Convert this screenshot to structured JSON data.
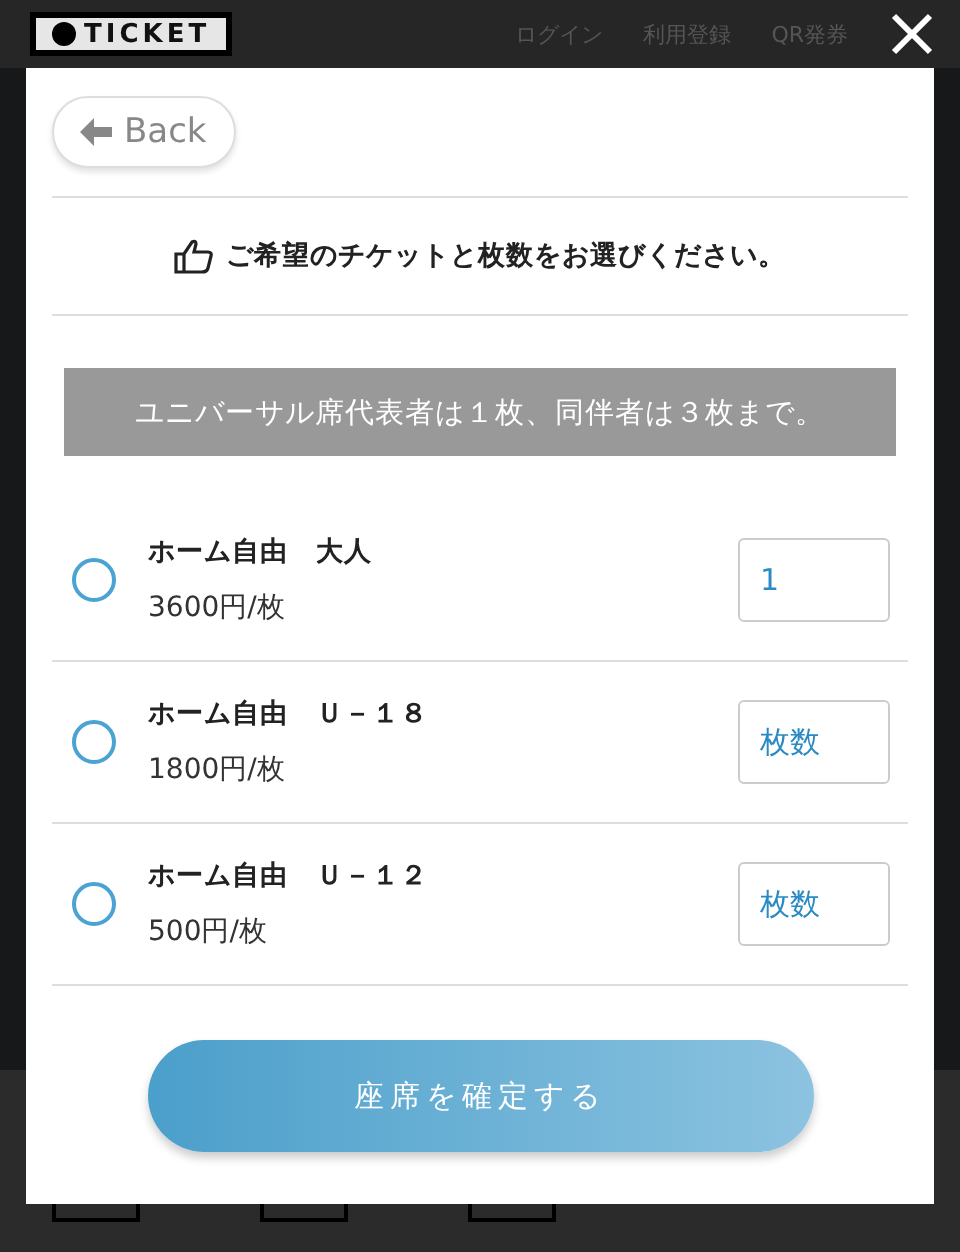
{
  "header": {
    "logo": "TICKET",
    "nav": [
      "ログイン",
      "利用登録",
      "QR発券"
    ]
  },
  "modal": {
    "back": "Back",
    "instruction": "ご希望のチケットと枚数をお選びください。",
    "notice": "ユニバーサル席代表者は１枚、同伴者は３枚まで。",
    "tickets": [
      {
        "name": "ホーム自由　大人",
        "price": "3600円/枚",
        "selected": false,
        "value": "1"
      },
      {
        "name": "ホーム自由　Ｕ－１８",
        "price": "1800円/枚",
        "selected": false,
        "placeholder": "枚数"
      },
      {
        "name": "ホーム自由　Ｕ－１２",
        "price": "500円/枚",
        "selected": false,
        "placeholder": "枚数"
      }
    ],
    "confirm": "座席を確定する"
  }
}
